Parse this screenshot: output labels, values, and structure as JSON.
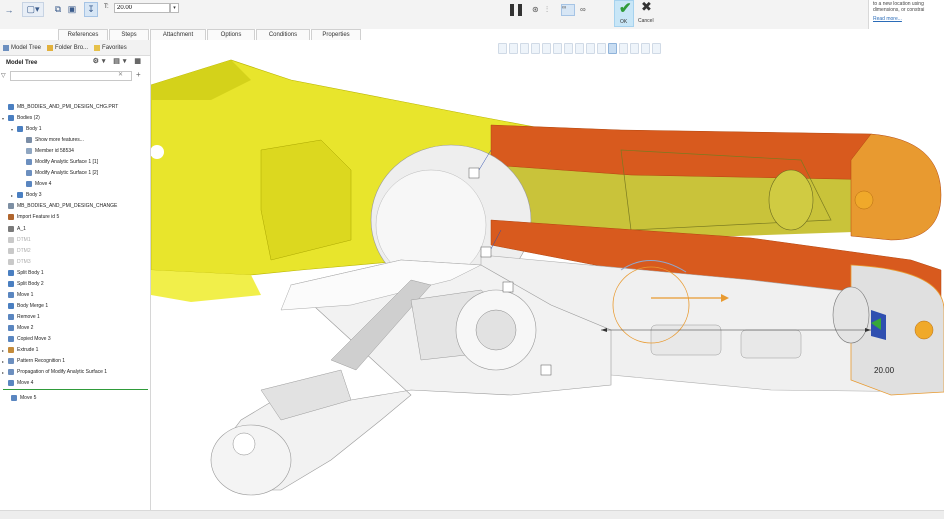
{
  "ribbon": {
    "t_label": "T:",
    "t_value": "20.00",
    "tabs": [
      {
        "label": "References"
      },
      {
        "label": "Steps"
      },
      {
        "label": "Attachment"
      },
      {
        "label": "Options"
      },
      {
        "label": "Conditions"
      },
      {
        "label": "Properties"
      }
    ],
    "ok_label": "OK",
    "cancel_label": "Cancel",
    "help_text": "to a new location using dimensions, or constrai",
    "help_link": "Read more..."
  },
  "panel": {
    "tabs": [
      {
        "label": "Model Tree"
      },
      {
        "label": "Folder Bro..."
      },
      {
        "label": "Favorites"
      }
    ],
    "title": "Model Tree",
    "filter_value": "",
    "tree": [
      {
        "label": "MB_BODIES_AND_PMI_DESIGN_CHG.PRT",
        "color": "#4a7fc1"
      },
      {
        "label": "Bodies (2)",
        "color": "#4a7fc1"
      },
      {
        "label": "Body 1",
        "color": "#4a7fc1"
      },
      {
        "label": "Show more features...",
        "color": "#7a8da6"
      },
      {
        "label": "Member id 58534",
        "color": "#8fa6c1"
      },
      {
        "label": "Modify Analytic Surface 1 [1]",
        "color": "#6c8fbf"
      },
      {
        "label": "Modify Analytic Surface 1 [2]",
        "color": "#6c8fbf"
      },
      {
        "label": "Move 4",
        "color": "#5a86c0"
      },
      {
        "label": "Body 3",
        "color": "#4a7fc1"
      },
      {
        "label": "MB_BODIES_AND_PMI_DESIGN_CHANGE",
        "color": "#7d8fa3"
      },
      {
        "label": "Import Feature id 5",
        "color": "#b0652d"
      },
      {
        "label": "A_1",
        "color": "#7a7a7a"
      },
      {
        "label": "DTM1",
        "color": "#c9c9c9"
      },
      {
        "label": "DTM2",
        "color": "#c9c9c9"
      },
      {
        "label": "DTM3",
        "color": "#c9c9c9"
      },
      {
        "label": "Split Body 1",
        "color": "#4a7fc1"
      },
      {
        "label": "Split Body 2",
        "color": "#4a7fc1"
      },
      {
        "label": "Move 1",
        "color": "#5a86c0"
      },
      {
        "label": "Body Merge 1",
        "color": "#4a7fc1"
      },
      {
        "label": "Remove 1",
        "color": "#5a86c0"
      },
      {
        "label": "Move 2",
        "color": "#5a86c0"
      },
      {
        "label": "Copied Move 3",
        "color": "#5a86c0"
      },
      {
        "label": "Extrude 1",
        "color": "#c48b3a"
      },
      {
        "label": "Pattern Recognition 1",
        "color": "#6c8fbf"
      },
      {
        "label": "Propagation of Modify Analytic Surface 1",
        "color": "#6c8fbf"
      },
      {
        "label": "Move 4",
        "color": "#5a86c0"
      }
    ],
    "insert_item": {
      "label": "Move 5",
      "color": "#5a86c0"
    }
  },
  "viewport": {
    "dimension_value": "20.00"
  }
}
